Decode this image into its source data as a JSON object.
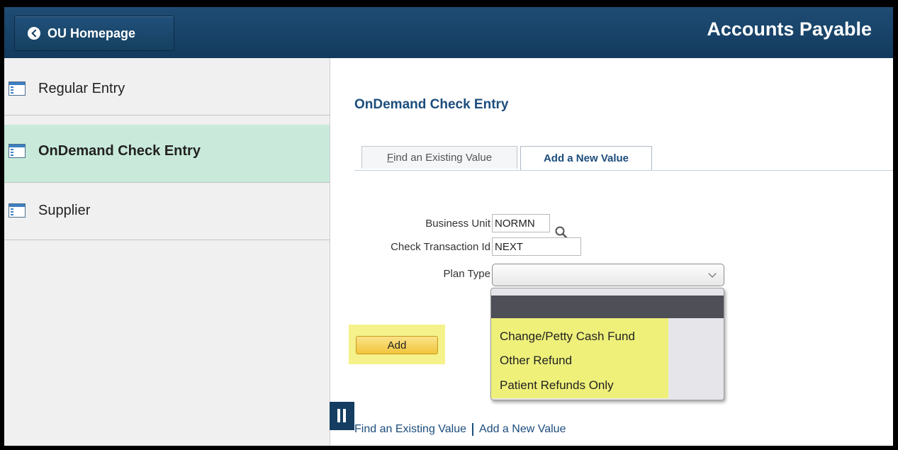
{
  "header": {
    "back_label": "OU Homepage",
    "app_title": "Accounts Payable"
  },
  "sidebar": {
    "items": [
      {
        "label": "Regular Entry",
        "icon": "list-page-icon"
      },
      {
        "label": "OnDemand Check Entry",
        "icon": "list-page-icon",
        "active": true
      },
      {
        "label": "Supplier",
        "icon": "list-page-icon"
      }
    ]
  },
  "main": {
    "page_title": "OnDemand Check Entry",
    "tabs": [
      {
        "label_first": "F",
        "label_rest": "ind an Existing Value"
      },
      {
        "label": "Add a New Value",
        "active": true
      }
    ],
    "fields": {
      "business_unit": {
        "label": "Business Unit",
        "value": "NORMN"
      },
      "check_transaction_id": {
        "label": "Check Transaction Id",
        "value": "NEXT"
      },
      "plan_type": {
        "label": "Plan Type",
        "value": ""
      }
    },
    "plan_type_options": [
      "",
      "Change/Petty Cash Fund",
      "Other Refund",
      "Patient Refunds Only"
    ],
    "add_button": "Add",
    "bottom_links": [
      "Find an Existing Value",
      "Add a New Value"
    ]
  },
  "colors": {
    "header_bg": "#1a466c",
    "title_blue": "#1c4d7c",
    "active_nav_bg": "#c9eadb",
    "highlight_yellow": "#eff07a",
    "add_button_gold": "#f2c53c"
  }
}
